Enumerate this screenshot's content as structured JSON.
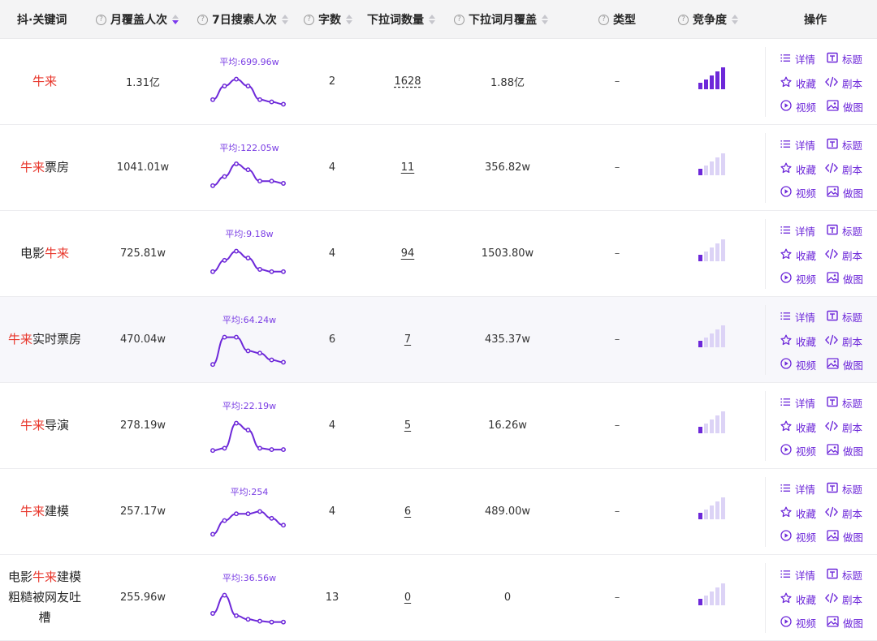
{
  "headers": {
    "keyword": "抖·关键词",
    "monthly_cover": "月覆盖人次",
    "weekly_search": "7日搜索人次",
    "char_count": "字数",
    "dropdown_count": "下拉词数量",
    "dropdown_cover": "下拉词月覆盖",
    "type": "类型",
    "competition": "竞争度",
    "actions": "操作"
  },
  "actions": {
    "detail": "详情",
    "title": "标题",
    "favorite": "收藏",
    "script": "剧本",
    "video": "视频",
    "image": "做图"
  },
  "rows": [
    {
      "kw_pre": "",
      "kw_hl": "牛来",
      "kw_post": "",
      "monthly": "1.31亿",
      "avg": "平均:699.96w",
      "trend": [
        2,
        5,
        6.5,
        5,
        2,
        1.5,
        1
      ],
      "chars": "2",
      "dropdown": "1628",
      "dropdown_cover": "1.88亿",
      "type": "–",
      "competition": 5
    },
    {
      "kw_pre": "",
      "kw_hl": "牛来",
      "kw_post": "票房",
      "monthly": "1041.01w",
      "avg": "平均:122.05w",
      "trend": [
        2,
        4,
        6.8,
        5.5,
        3,
        3,
        2.5
      ],
      "chars": "4",
      "dropdown": "11",
      "dropdown_cover": "356.82w",
      "type": "–",
      "competition": 1
    },
    {
      "kw_pre": "电影",
      "kw_hl": "牛来",
      "kw_post": "",
      "monthly": "725.81w",
      "avg": "平均:9.18w",
      "trend": [
        2,
        4.5,
        6.5,
        5,
        2.5,
        2,
        2
      ],
      "chars": "4",
      "dropdown": "94",
      "dropdown_cover": "1503.80w",
      "type": "–",
      "competition": 1
    },
    {
      "kw_pre": "",
      "kw_hl": "牛来",
      "kw_post": "实时票房",
      "monthly": "470.04w",
      "avg": "平均:64.24w",
      "trend": [
        0.5,
        6.5,
        6.5,
        3.5,
        3,
        1.5,
        1
      ],
      "chars": "6",
      "dropdown": "7",
      "dropdown_cover": "435.37w",
      "type": "–",
      "competition": 1
    },
    {
      "kw_pre": "",
      "kw_hl": "牛来",
      "kw_post": "导演",
      "monthly": "278.19w",
      "avg": "平均:22.19w",
      "trend": [
        0.5,
        1,
        6.5,
        5,
        1,
        0.7,
        0.7
      ],
      "chars": "4",
      "dropdown": "5",
      "dropdown_cover": "16.26w",
      "type": "–",
      "competition": 1
    },
    {
      "kw_pre": "",
      "kw_hl": "牛来",
      "kw_post": "建模",
      "monthly": "257.17w",
      "avg": "平均:254",
      "trend": [
        1,
        4,
        5.5,
        5.5,
        6,
        4.5,
        3
      ],
      "chars": "4",
      "dropdown": "6",
      "dropdown_cover": "489.00w",
      "type": "–",
      "competition": 1
    },
    {
      "kw_pre": "电影",
      "kw_hl": "牛来",
      "kw_post": "建模",
      "kw_line2": "粗糙被网友吐",
      "kw_line3": "槽",
      "monthly": "255.96w",
      "avg": "平均:36.56w",
      "trend": [
        2.5,
        6.5,
        2,
        1.2,
        0.8,
        0.6,
        0.6
      ],
      "chars": "13",
      "dropdown": "0",
      "dropdown_cover": "0",
      "type": "–",
      "competition": 1
    }
  ],
  "colors": {
    "accent": "#6d28d9",
    "highlight": "#e8372c",
    "bar_off": "#dcd3f6"
  },
  "icons": [
    "question-icon",
    "list-icon",
    "title-icon",
    "star-icon",
    "code-icon",
    "play-icon",
    "image-icon"
  ]
}
